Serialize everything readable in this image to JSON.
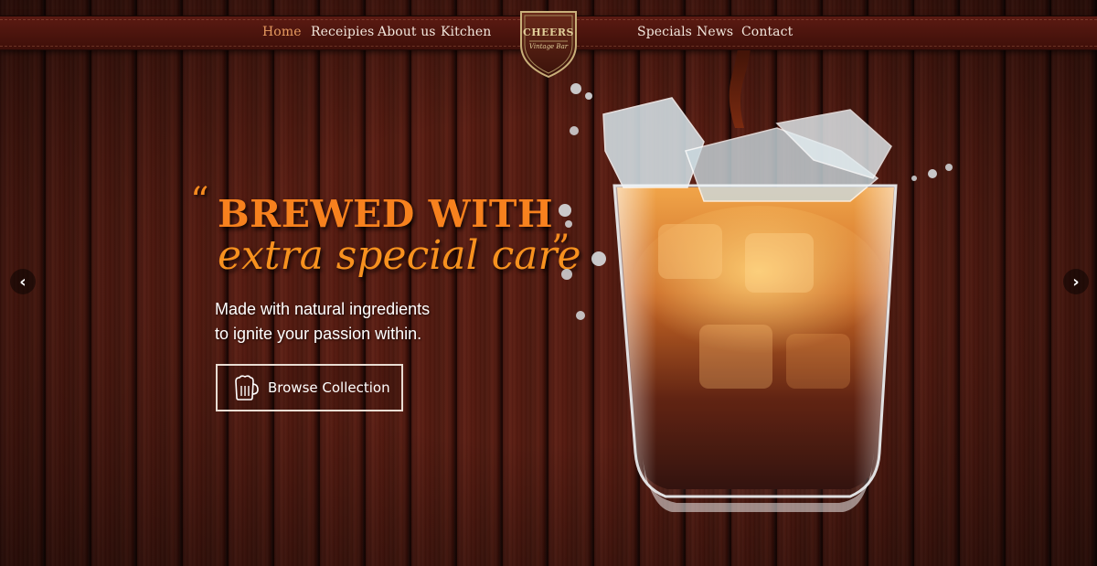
{
  "nav": {
    "left": [
      {
        "label": "Home",
        "active": true
      },
      {
        "label": "Receipies",
        "active": false
      },
      {
        "label": "About us",
        "active": false
      },
      {
        "label": "Kitchen",
        "active": false
      }
    ],
    "right": [
      {
        "label": "Specials"
      },
      {
        "label": "News"
      },
      {
        "label": "Contact"
      }
    ],
    "active_color": "#e69a60"
  },
  "logo": {
    "title": "CHEERS",
    "subtitle": "Vintage Bar"
  },
  "hero": {
    "quote_open": "“",
    "quote_close": "”",
    "headline_line1": "BREWED WITH",
    "headline_line2": "extra special care",
    "subtext_line1": "Made with natural ingredients",
    "subtext_line2": "to ignite your passion within.",
    "cta_label": "Browse Collection",
    "cta_icon": "beer-mug-icon",
    "accent_color": "#f7811e"
  },
  "slider": {
    "prev_icon": "chevron-left-icon",
    "next_icon": "chevron-right-icon",
    "prev_glyph": "‹",
    "next_glyph": "›"
  }
}
